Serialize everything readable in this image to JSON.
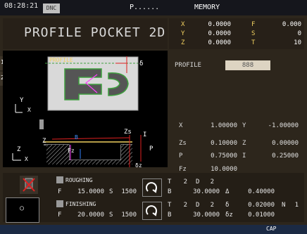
{
  "topbar": {
    "time": "08:28:21",
    "mode": "DNC",
    "program": "P......",
    "memory": "MEMORY"
  },
  "title": "PROFILE POCKET 2D",
  "coords": [
    {
      "axis": "X",
      "value": "0.0000",
      "axis2": "F",
      "value2": "0.000"
    },
    {
      "axis": "Y",
      "value": "0.0000",
      "axis2": "S",
      "value2": "0"
    },
    {
      "axis": "Z",
      "value": "0.0000",
      "axis2": "T",
      "value2": "10"
    }
  ],
  "side_tabs": [
    "1",
    "2"
  ],
  "graphic": {
    "profile_label": "PROFILE",
    "delta": "δ",
    "axis_y": "Y",
    "axis_x": "X",
    "axis_z": "Z",
    "zs": "Zs",
    "beta": "B",
    "fz": "Fz",
    "i": "I",
    "p": "P",
    "dz": "δz"
  },
  "panel": {
    "profile_label": "PROFILE",
    "profile_value": "888",
    "rows": [
      {
        "l1": "X",
        "v1": "1.00000",
        "l2": "Y",
        "v2": "-1.00000"
      },
      {
        "l1": "Zs",
        "v1": "0.10000",
        "l2": "Z",
        "v2": "0.00000"
      },
      {
        "l1": "P",
        "v1": "0.75000",
        "l2": "I",
        "v2": "0.25000"
      },
      {
        "l1": "Fz",
        "v1": "10.0000",
        "l2": "",
        "v2": ""
      }
    ]
  },
  "roughing": {
    "label": "ROUGHING",
    "f_label": "F",
    "f": "15.0000",
    "s_label": "S",
    "s": "1500",
    "t_label": "T",
    "t": "2",
    "d_label": "D",
    "d": "2",
    "b_label": "B",
    "b": "30.0000",
    "delta_label": "Δ",
    "delta": "0.40000"
  },
  "finishing": {
    "label": "FINISHING",
    "f_label": "F",
    "f": "20.0000",
    "s_label": "S",
    "s": "1500",
    "t_label": "T",
    "t": "2",
    "d_label": "D",
    "d": "2",
    "b_label": "B",
    "b": "30.0000",
    "dz_label": "δz",
    "dz": "0.01000",
    "delta_label": "δ",
    "delta": "0.02000",
    "n_label": "N",
    "n": "1"
  },
  "status": {
    "cap": "CAP"
  },
  "colors": {
    "accent": "#f0d060",
    "graphic_bg": "#000000",
    "panel_bg": "#2d261c",
    "status_bar": "#1b2a44"
  }
}
